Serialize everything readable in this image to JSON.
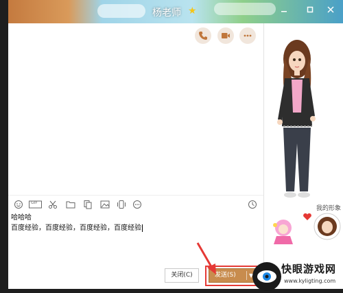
{
  "window": {
    "title": "杨老师",
    "star_icon": "star-icon",
    "controls": [
      "minimize-icon",
      "maximize-icon",
      "close-icon"
    ]
  },
  "header_actions": [
    "phone-icon",
    "video-icon",
    "more-icon"
  ],
  "toolbar": {
    "icons": [
      "emoji-icon",
      "gif-icon",
      "scissors-icon",
      "folder-icon",
      "image-file-icon",
      "picture-icon",
      "shake-icon",
      "more-circle-icon",
      "history-clock-icon"
    ],
    "gif_label": "GIF"
  },
  "composer": {
    "line1": "哈哈哈",
    "line2": "百度经验，百度经验，百度经验，百度经验"
  },
  "buttons": {
    "close_label": "关闭(C)",
    "send_label": "发送(S)",
    "send_dropdown": "▼"
  },
  "sidebar": {
    "avatar_label": "我的形象"
  },
  "colors": {
    "accent": "#c88c4e",
    "highlight": "#e53935"
  },
  "watermark": {
    "name": "快眼游戏网",
    "url": "www.kyligting.com"
  }
}
